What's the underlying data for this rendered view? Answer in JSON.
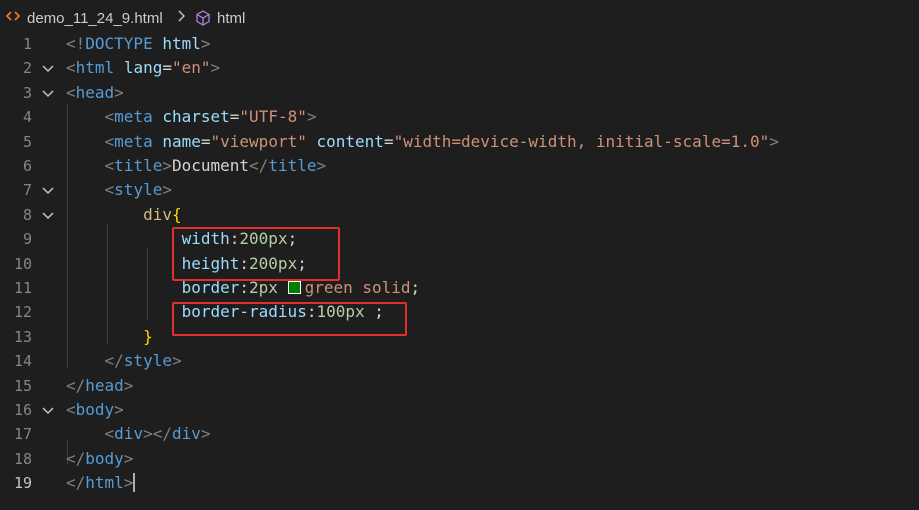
{
  "breadcrumb": {
    "file_name": "demo_11_24_9.html",
    "separator": ">",
    "symbol": "html",
    "file_icon": "html-angle-brackets-icon",
    "symbol_icon": "cube-symbol-icon"
  },
  "editor": {
    "line_numbers": [
      "1",
      "2",
      "3",
      "4",
      "5",
      "6",
      "7",
      "8",
      "9",
      "10",
      "11",
      "12",
      "13",
      "14",
      "15",
      "16",
      "17",
      "18",
      "19"
    ],
    "active_line": "19",
    "lines": [
      {
        "parts": [
          {
            "c": "p",
            "t": "<!"
          },
          {
            "c": "t",
            "t": "DOCTYPE"
          },
          {
            "c": "x",
            "t": " "
          },
          {
            "c": "a",
            "t": "html"
          },
          {
            "c": "p",
            "t": ">"
          }
        ]
      },
      {
        "parts": [
          {
            "c": "p",
            "t": "<"
          },
          {
            "c": "t",
            "t": "html"
          },
          {
            "c": "x",
            "t": " "
          },
          {
            "c": "a",
            "t": "lang"
          },
          {
            "c": "x",
            "t": "="
          },
          {
            "c": "s",
            "t": "\"en\""
          },
          {
            "c": "p",
            "t": ">"
          }
        ]
      },
      {
        "parts": [
          {
            "c": "p",
            "t": "<"
          },
          {
            "c": "t",
            "t": "head"
          },
          {
            "c": "p",
            "t": ">"
          }
        ]
      },
      {
        "parts": [
          {
            "c": "x",
            "t": "    "
          },
          {
            "c": "p",
            "t": "<"
          },
          {
            "c": "t",
            "t": "meta"
          },
          {
            "c": "x",
            "t": " "
          },
          {
            "c": "a",
            "t": "charset"
          },
          {
            "c": "x",
            "t": "="
          },
          {
            "c": "s",
            "t": "\"UTF-8\""
          },
          {
            "c": "p",
            "t": ">"
          }
        ]
      },
      {
        "parts": [
          {
            "c": "x",
            "t": "    "
          },
          {
            "c": "p",
            "t": "<"
          },
          {
            "c": "t",
            "t": "meta"
          },
          {
            "c": "x",
            "t": " "
          },
          {
            "c": "a",
            "t": "name"
          },
          {
            "c": "x",
            "t": "="
          },
          {
            "c": "s",
            "t": "\"viewport\""
          },
          {
            "c": "x",
            "t": " "
          },
          {
            "c": "a",
            "t": "content"
          },
          {
            "c": "x",
            "t": "="
          },
          {
            "c": "s",
            "t": "\"width=device-width, initial-scale=1.0\""
          },
          {
            "c": "p",
            "t": ">"
          }
        ]
      },
      {
        "parts": [
          {
            "c": "x",
            "t": "    "
          },
          {
            "c": "p",
            "t": "<"
          },
          {
            "c": "t",
            "t": "title"
          },
          {
            "c": "p",
            "t": ">"
          },
          {
            "c": "x",
            "t": "Document"
          },
          {
            "c": "p",
            "t": "</"
          },
          {
            "c": "t",
            "t": "title"
          },
          {
            "c": "p",
            "t": ">"
          }
        ]
      },
      {
        "parts": [
          {
            "c": "x",
            "t": "    "
          },
          {
            "c": "p",
            "t": "<"
          },
          {
            "c": "t",
            "t": "style"
          },
          {
            "c": "p",
            "t": ">"
          }
        ]
      },
      {
        "parts": [
          {
            "c": "x",
            "t": "        "
          },
          {
            "c": "sel",
            "t": "div"
          },
          {
            "c": "br",
            "t": "{"
          }
        ]
      },
      {
        "parts": [
          {
            "c": "x",
            "t": "            "
          },
          {
            "c": "a",
            "t": "width"
          },
          {
            "c": "x",
            "t": ":"
          },
          {
            "c": "n",
            "t": "200px"
          },
          {
            "c": "x",
            "t": ";"
          }
        ]
      },
      {
        "parts": [
          {
            "c": "x",
            "t": "            "
          },
          {
            "c": "a",
            "t": "height"
          },
          {
            "c": "x",
            "t": ":"
          },
          {
            "c": "n",
            "t": "200px"
          },
          {
            "c": "x",
            "t": ";"
          }
        ]
      },
      {
        "parts": [
          {
            "c": "x",
            "t": "            "
          },
          {
            "c": "a",
            "t": "border"
          },
          {
            "c": "x",
            "t": ":"
          },
          {
            "c": "n",
            "t": "2px"
          },
          {
            "c": "x",
            "t": " "
          },
          {
            "c": "swatch",
            "t": ""
          },
          {
            "c": "s",
            "t": "green solid"
          },
          {
            "c": "x",
            "t": ";"
          }
        ]
      },
      {
        "parts": [
          {
            "c": "x",
            "t": "            "
          },
          {
            "c": "a",
            "t": "border-radius"
          },
          {
            "c": "x",
            "t": ":"
          },
          {
            "c": "n",
            "t": "100px"
          },
          {
            "c": "x",
            "t": " ;"
          }
        ]
      },
      {
        "parts": [
          {
            "c": "x",
            "t": "        "
          },
          {
            "c": "br",
            "t": "}"
          }
        ]
      },
      {
        "parts": [
          {
            "c": "x",
            "t": "    "
          },
          {
            "c": "p",
            "t": "</"
          },
          {
            "c": "t",
            "t": "style"
          },
          {
            "c": "p",
            "t": ">"
          }
        ]
      },
      {
        "parts": [
          {
            "c": "p",
            "t": "</"
          },
          {
            "c": "t",
            "t": "head"
          },
          {
            "c": "p",
            "t": ">"
          }
        ]
      },
      {
        "parts": [
          {
            "c": "p",
            "t": "<"
          },
          {
            "c": "t",
            "t": "body"
          },
          {
            "c": "p",
            "t": ">"
          }
        ]
      },
      {
        "parts": [
          {
            "c": "x",
            "t": "    "
          },
          {
            "c": "p",
            "t": "<"
          },
          {
            "c": "t",
            "t": "div"
          },
          {
            "c": "p",
            "t": "></"
          },
          {
            "c": "t",
            "t": "div"
          },
          {
            "c": "p",
            "t": ">"
          }
        ]
      },
      {
        "parts": [
          {
            "c": "p",
            "t": "</"
          },
          {
            "c": "t",
            "t": "body"
          },
          {
            "c": "p",
            "t": ">"
          }
        ]
      },
      {
        "parts": [
          {
            "c": "p",
            "t": "</"
          },
          {
            "c": "t",
            "t": "html"
          },
          {
            "c": "p",
            "t": ">"
          },
          {
            "c": "cursor",
            "t": ""
          }
        ]
      }
    ],
    "fold_lines": [
      "2",
      "3",
      "7",
      "8",
      "16"
    ],
    "highlight_color": "#e0302d",
    "swatch_color": "#008000"
  }
}
